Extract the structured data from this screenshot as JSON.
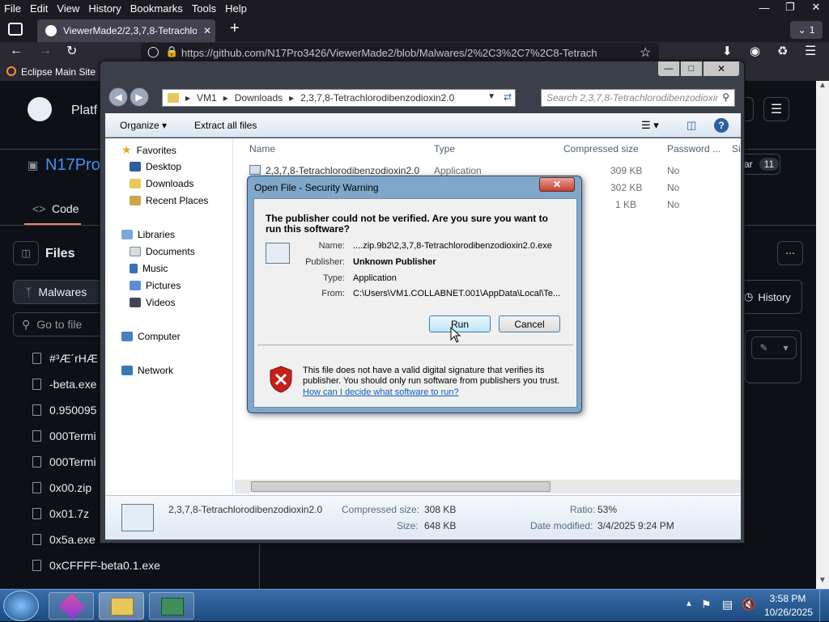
{
  "browser": {
    "menu": [
      "File",
      "Edit",
      "View",
      "History",
      "Bookmarks",
      "Tools",
      "Help"
    ],
    "tab_title": "ViewerMade2/2,3,7,8-Tetrachlor",
    "tab_count": "1",
    "url": "https://github.com/N17Pro3426/ViewerMade2/blob/Malwares/2%2C3%2C7%2C8-Tetrach",
    "bookmark": "Eclipse Main Site"
  },
  "github": {
    "platform": "Platf",
    "repo": "N17Pro",
    "code_tab": "Code",
    "files_label": "Files",
    "branch": "Malwares",
    "goto": "Go to file",
    "history": "History",
    "star_count": "11",
    "star_label": "ar",
    "files": [
      "#³Æ´rHÆ",
      "-beta.exe",
      "0.950095",
      "000Termi",
      "000Termi",
      "0x00.zip",
      "0x01.7z",
      "0x5a.exe",
      "0xCFFFF-beta0.1.exe"
    ]
  },
  "explorer": {
    "breadcrumb": [
      "VM1",
      "Downloads",
      "2,3,7,8-Tetrachlorodibenzodioxin2.0"
    ],
    "search_placeholder": "Search 2,3,7,8-Tetrachlorodibenzodioxin...",
    "organize": "Organize",
    "extract": "Extract all files",
    "nav": {
      "favorites": "Favorites",
      "desktop": "Desktop",
      "downloads": "Downloads",
      "recent": "Recent Places",
      "libraries": "Libraries",
      "documents": "Documents",
      "music": "Music",
      "pictures": "Pictures",
      "videos": "Videos",
      "computer": "Computer",
      "network": "Network"
    },
    "columns": [
      "Name",
      "Type",
      "Compressed size",
      "Password ...",
      "Si"
    ],
    "rows": [
      {
        "name": "2,3,7,8-Tetrachlorodibenzodioxin2.0",
        "type": "Application",
        "size": "309 KB",
        "pw": "No"
      },
      {
        "name": "",
        "type": "",
        "size": "302 KB",
        "pw": "No"
      },
      {
        "name": "",
        "type": "",
        "size": "1 KB",
        "pw": "No"
      }
    ],
    "details": {
      "name": "2,3,7,8-Tetrachlorodibenzodioxin2.0",
      "compressed_label": "Compressed size:",
      "compressed": "308 KB",
      "size_label": "Size:",
      "size": "648 KB",
      "ratio_label": "Ratio:",
      "ratio": "53%",
      "modified_label": "Date modified:",
      "modified": "3/4/2025 9:24 PM"
    }
  },
  "dialog": {
    "title": "Open File - Security Warning",
    "question": "The publisher could not be verified.  Are you sure you want to run this software?",
    "name_label": "Name:",
    "name": "....zip.9b2\\2,3,7,8-Tetrachlorodibenzodioxin2.0.exe",
    "publisher_label": "Publisher:",
    "publisher": "Unknown Publisher",
    "type_label": "Type:",
    "type": "Application",
    "from_label": "From:",
    "from": "C:\\Users\\VM1.COLLABNET.001\\AppData\\Local\\Te...",
    "run": "Run",
    "cancel": "Cancel",
    "warning": "This file does not have a valid digital signature that verifies its publisher.  You should only run software from publishers you trust.",
    "link": "How can I decide what software to run?"
  },
  "taskbar": {
    "time": "3:58 PM",
    "date": "10/26/2025"
  }
}
